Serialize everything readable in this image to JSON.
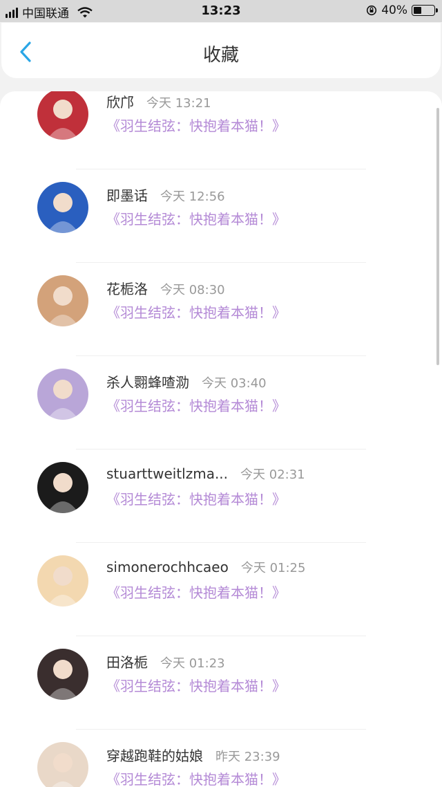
{
  "status_bar": {
    "carrier": "中国联通",
    "time": "13:23",
    "battery": "40%",
    "battery_level": 0.4
  },
  "header": {
    "title": "收藏",
    "back_icon": "chevron-left-icon"
  },
  "favorites": [
    {
      "name": "欣邝",
      "time": "今天 13:21",
      "subtitle": "《羽生结弦：快抱着本猫！》",
      "avatar_color": "#c0303a"
    },
    {
      "name": "即墨话",
      "time": "今天 12:56",
      "subtitle": "《羽生结弦：快抱着本猫！》",
      "avatar_color": "#2a5fbf"
    },
    {
      "name": "花栀洛",
      "time": "今天 08:30",
      "subtitle": "《羽生结弦：快抱着本猫！》",
      "avatar_color": "#d3a27a"
    },
    {
      "name": "杀人翾蜂喳泐",
      "time": "今天 03:40",
      "subtitle": "《羽生结弦：快抱着本猫！》",
      "avatar_color": "#b9a6d8"
    },
    {
      "name": "stuarttweitlzma...",
      "time": "今天 02:31",
      "subtitle": "《羽生结弦：快抱着本猫！》",
      "avatar_color": "#1b1b1b"
    },
    {
      "name": "simonerochhcaeo",
      "time": "今天 01:25",
      "subtitle": "《羽生结弦：快抱着本猫！》",
      "avatar_color": "#f3d8b0"
    },
    {
      "name": "田洛栀",
      "time": "今天 01:23",
      "subtitle": "《羽生结弦：快抱着本猫！》",
      "avatar_color": "#3a2e2e"
    },
    {
      "name": "穿越跑鞋的姑娘",
      "time": "昨天 23:39",
      "subtitle": "《羽生结弦：快抱着本猫！》",
      "avatar_color": "#e9d8c8"
    }
  ]
}
